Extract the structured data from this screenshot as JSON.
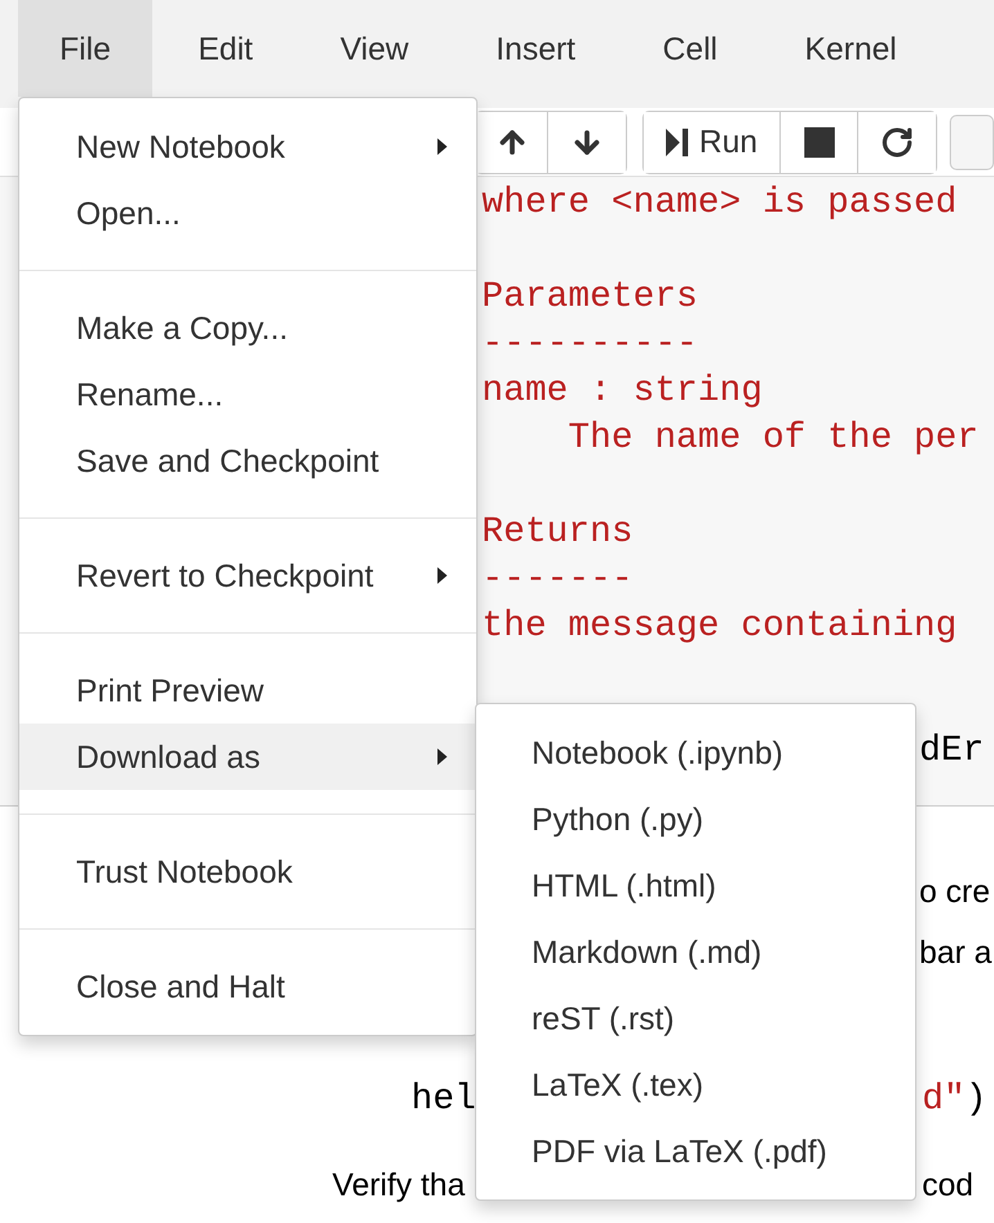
{
  "menubar": [
    {
      "label": "File",
      "selected": true
    },
    {
      "label": "Edit",
      "selected": false
    },
    {
      "label": "View",
      "selected": false
    },
    {
      "label": "Insert",
      "selected": false
    },
    {
      "label": "Cell",
      "selected": false
    },
    {
      "label": "Kernel",
      "selected": false
    }
  ],
  "toolbar": {
    "run_label": "Run"
  },
  "code_cell": {
    "blocks": [
      [
        "where <name> is passed"
      ],
      [
        "Parameters",
        "----------",
        "name : string",
        "    The name of the per"
      ],
      [
        "Returns",
        "-------",
        "the message containing"
      ]
    ],
    "tail": "dEr"
  },
  "markdown_fragments": [
    "o cre",
    "bar a"
  ],
  "code_example": {
    "left": "hel",
    "right": [
      {
        "text": "d\"",
        "kind": "string"
      },
      {
        "text": ")",
        "kind": "plain"
      }
    ]
  },
  "paragraph": {
    "left": "Verify tha",
    "right": "cod"
  },
  "file_menu": {
    "sections": [
      [
        {
          "label": "New Notebook",
          "has_submenu": true,
          "selected": false
        },
        {
          "label": "Open...",
          "has_submenu": false,
          "selected": false
        }
      ],
      [
        {
          "label": "Make a Copy...",
          "has_submenu": false,
          "selected": false
        },
        {
          "label": "Rename...",
          "has_submenu": false,
          "selected": false
        },
        {
          "label": "Save and Checkpoint",
          "has_submenu": false,
          "selected": false
        }
      ],
      [
        {
          "label": "Revert to Checkpoint",
          "has_submenu": true,
          "selected": false
        }
      ],
      [
        {
          "label": "Print Preview",
          "has_submenu": false,
          "selected": false
        },
        {
          "label": "Download as",
          "has_submenu": true,
          "selected": true
        }
      ],
      [
        {
          "label": "Trust Notebook",
          "has_submenu": false,
          "selected": false
        }
      ],
      [
        {
          "label": "Close and Halt",
          "has_submenu": false,
          "selected": false
        }
      ]
    ]
  },
  "download_submenu": {
    "items": [
      {
        "label": "Notebook (.ipynb)",
        "selected": false
      },
      {
        "label": "Python (.py)",
        "selected": false
      },
      {
        "label": "HTML (.html)",
        "selected": false
      },
      {
        "label": "Markdown (.md)",
        "selected": false
      },
      {
        "label": "reST (.rst)",
        "selected": false
      },
      {
        "label": "LaTeX (.tex)",
        "selected": false
      },
      {
        "label": "PDF via LaTeX (.pdf)",
        "selected": false
      }
    ]
  }
}
